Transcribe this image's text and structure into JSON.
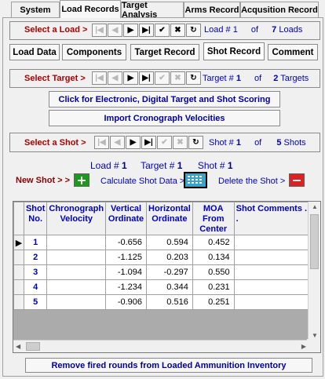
{
  "top_tabs": [
    "System",
    "Load Records",
    "Target Analysis",
    "Arms Record",
    "Acqusition Record"
  ],
  "load_nav": {
    "label": "Select a Load >",
    "prefix": "Load #",
    "current": "1",
    "of": "of",
    "total": "7",
    "suffix": "Loads"
  },
  "sub_tabs": [
    "Load Data",
    "Components",
    "Target Record",
    "Shot Record",
    "Comment"
  ],
  "target_nav": {
    "label": "Select Target >",
    "prefix": "Target #",
    "current": "1",
    "of": "of",
    "total": "2",
    "suffix": "Targets"
  },
  "buttons": {
    "electronic": "Click for Electronic, Digital Target and Shot Scoring",
    "import": "Import Cronograph Velocities",
    "remove": "Remove fired rounds from Loaded Ammunition  Inventory"
  },
  "shot_nav": {
    "label": "Select a Shot >",
    "prefix": "Shot #",
    "current": "1",
    "of": "of",
    "total": "5",
    "suffix": "Shots"
  },
  "info": {
    "load_label": "Load #",
    "load_val": "1",
    "target_label": "Target #",
    "target_val": "1",
    "shot_label": "Shot #",
    "shot_val": "1"
  },
  "actions": {
    "new_shot": "New Shot > >",
    "calc": "Calculate Shot Data >",
    "delete": "Delete  the Shot >"
  },
  "table": {
    "headers": [
      "Shot No.",
      "Chronograph Velocity",
      "Vertical Ordinate",
      "Horizontal Ordinate",
      "MOA From Center",
      "Shot Comments  . . . ."
    ],
    "rows": [
      [
        "1",
        "",
        "-0.656",
        "0.594",
        "0.452",
        ""
      ],
      [
        "2",
        "",
        "-1.125",
        "0.203",
        "0.134",
        ""
      ],
      [
        "3",
        "",
        "-1.094",
        "-0.297",
        "0.550",
        ""
      ],
      [
        "4",
        "",
        "-1.234",
        "0.344",
        "0.231",
        ""
      ],
      [
        "5",
        "",
        "-0.906",
        "0.516",
        "0.251",
        ""
      ]
    ]
  },
  "colors": {
    "label_red": "#b00000",
    "blue_text": "#0000c0",
    "add_green": "#1a9b1a",
    "delete_red": "#e02020"
  }
}
